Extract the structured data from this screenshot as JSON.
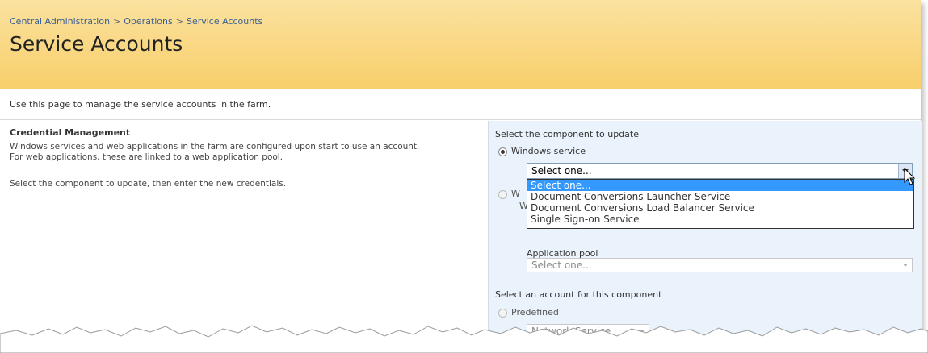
{
  "breadcrumb": {
    "item1": "Central Administration",
    "sep": ">",
    "item2": "Operations",
    "item3": "Service Accounts"
  },
  "page_title": "Service Accounts",
  "intro": "Use this page to manage the service accounts in the farm.",
  "credential": {
    "title": "Credential Management",
    "line1": "Windows services and web applications in the farm are configured upon start to use an account.",
    "line2": "For web applications, these are linked to a web application pool.",
    "line3": "Select the component to update, then enter the new credentials."
  },
  "panel": {
    "component_heading": "Select the component to update",
    "windows_service_label": "Windows service",
    "service_select_value": "Select one...",
    "dropdown_options": [
      "Select one...",
      "Document Conversions Launcher Service",
      "Document Conversions Load Balancer Service",
      "Single Sign-on Service"
    ],
    "web_app_label_partial": "W",
    "web_app_sub_partial": "W",
    "app_pool_label": "Application pool",
    "app_pool_value": "Select one...",
    "account_heading": "Select an account for this component",
    "predefined_label": "Predefined",
    "predefined_value": "Network Service"
  },
  "colors": {
    "header_bg": "#f8cf6a",
    "panel_bg": "#eaf2fb",
    "link": "#3a5f92",
    "selection": "#3399ff"
  }
}
